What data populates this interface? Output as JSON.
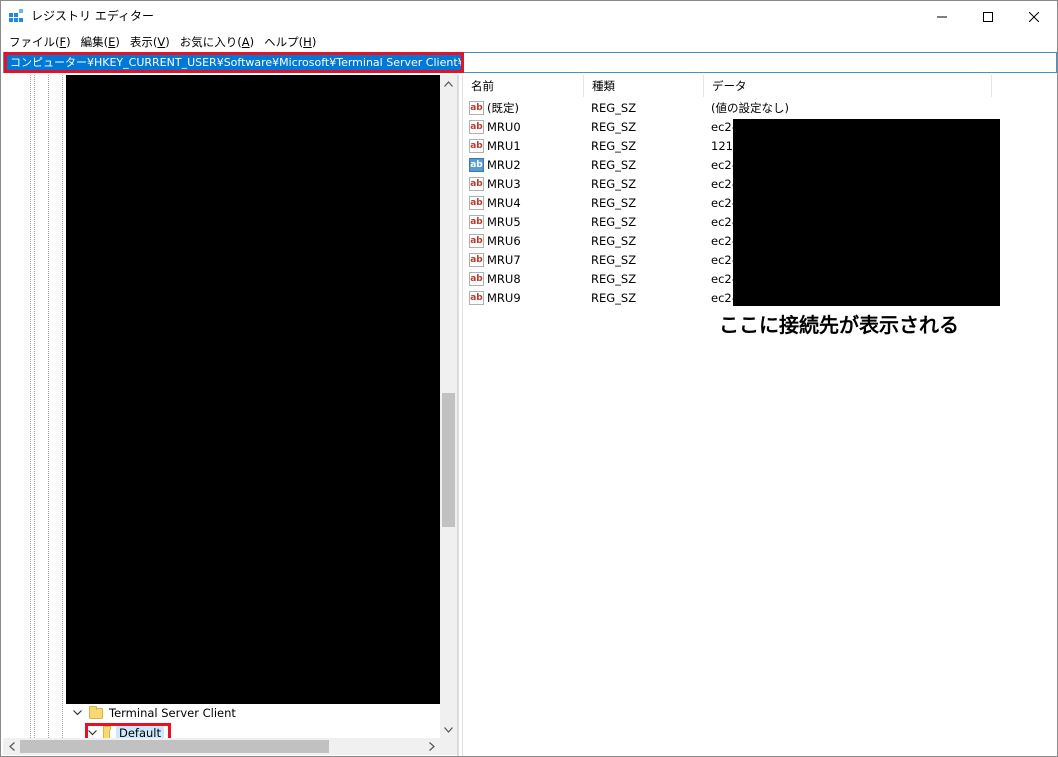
{
  "window": {
    "title": "レジストリ エディター",
    "controls": {
      "minimize": "minimize-icon",
      "maximize": "maximize-icon",
      "close": "close-icon"
    }
  },
  "menu": [
    {
      "label": "ファイル(",
      "key": "F",
      "end": ")"
    },
    {
      "label": "編集(",
      "key": "E",
      "end": ")"
    },
    {
      "label": "表示(",
      "key": "V",
      "end": ")"
    },
    {
      "label": "お気に入り(",
      "key": "A",
      "end": ")"
    },
    {
      "label": "ヘルプ(",
      "key": "H",
      "end": ")"
    }
  ],
  "address": {
    "path": "コンピューター¥HKEY_CURRENT_USER¥Software¥Microsoft¥Terminal Server Client¥Default"
  },
  "tree": {
    "parent_label": "Terminal Server Client",
    "selected_label": "Default"
  },
  "list": {
    "columns": {
      "name": "名前",
      "type": "種類",
      "data": "データ"
    },
    "rows": [
      {
        "name": "(既定)",
        "type": "REG_SZ",
        "data": "(値の設定なし)",
        "selected": false
      },
      {
        "name": "MRU0",
        "type": "REG_SZ",
        "data": "ec2-",
        "selected": false
      },
      {
        "name": "MRU1",
        "type": "REG_SZ",
        "data": "121.",
        "selected": false
      },
      {
        "name": "MRU2",
        "type": "REG_SZ",
        "data": "ec2-",
        "selected": true
      },
      {
        "name": "MRU3",
        "type": "REG_SZ",
        "data": "ec2-",
        "selected": false
      },
      {
        "name": "MRU4",
        "type": "REG_SZ",
        "data": "ec2-",
        "selected": false
      },
      {
        "name": "MRU5",
        "type": "REG_SZ",
        "data": "ec2-",
        "selected": false
      },
      {
        "name": "MRU6",
        "type": "REG_SZ",
        "data": "ec2-",
        "selected": false
      },
      {
        "name": "MRU7",
        "type": "REG_SZ",
        "data": "ec2-",
        "selected": false
      },
      {
        "name": "MRU8",
        "type": "REG_SZ",
        "data": "ec2-",
        "selected": false
      },
      {
        "name": "MRU9",
        "type": "REG_SZ",
        "data": "ec2-",
        "selected": false
      }
    ]
  },
  "annotation": "ここに接続先が表示される",
  "icons": {
    "value_icon": "ab",
    "folder": "folder-icon"
  },
  "colors": {
    "highlight": "#e81123",
    "selection": "#0078d7",
    "folder": "#f8d775",
    "value_icon_text": "#c0392b"
  }
}
